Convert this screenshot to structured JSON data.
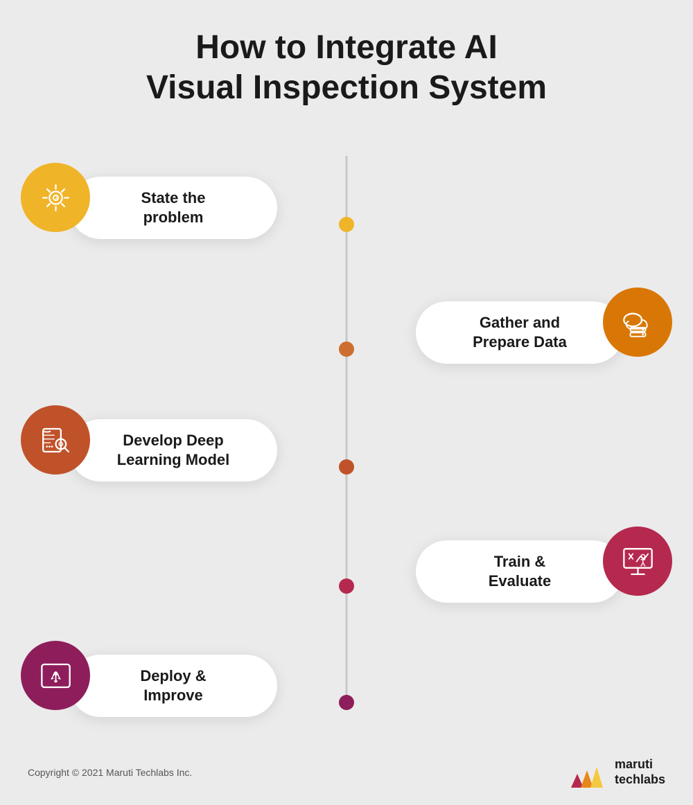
{
  "title": {
    "line1": "How to Integrate AI",
    "line2": "Visual Inspection System"
  },
  "steps": [
    {
      "id": 1,
      "side": "left",
      "label_line1": "State the",
      "label_line2": "problem",
      "icon_color": "#f0b429",
      "dot_color": "#f0b429",
      "icon_name": "problem-icon"
    },
    {
      "id": 2,
      "side": "right",
      "label_line1": "Gather and",
      "label_line2": "Prepare Data",
      "icon_color": "#d97706",
      "dot_color": "#cc6e30",
      "icon_name": "data-icon"
    },
    {
      "id": 3,
      "side": "left",
      "label_line1": "Develop Deep",
      "label_line2": "Learning Model",
      "icon_color": "#c0522a",
      "dot_color": "#c0522a",
      "icon_name": "model-icon"
    },
    {
      "id": 4,
      "side": "right",
      "label_line1": "Train &",
      "label_line2": "Evaluate",
      "icon_color": "#b5294e",
      "dot_color": "#b5294e",
      "icon_name": "train-icon"
    },
    {
      "id": 5,
      "side": "left",
      "label_line1": "Deploy &",
      "label_line2": "Improve",
      "icon_color": "#8e1e5b",
      "dot_color": "#8e1e5b",
      "icon_name": "deploy-icon"
    }
  ],
  "footer": {
    "copyright": "Copyright © 2021 Maruti Techlabs Inc.",
    "logo_line1": "maruti",
    "logo_line2": "techlabs"
  }
}
